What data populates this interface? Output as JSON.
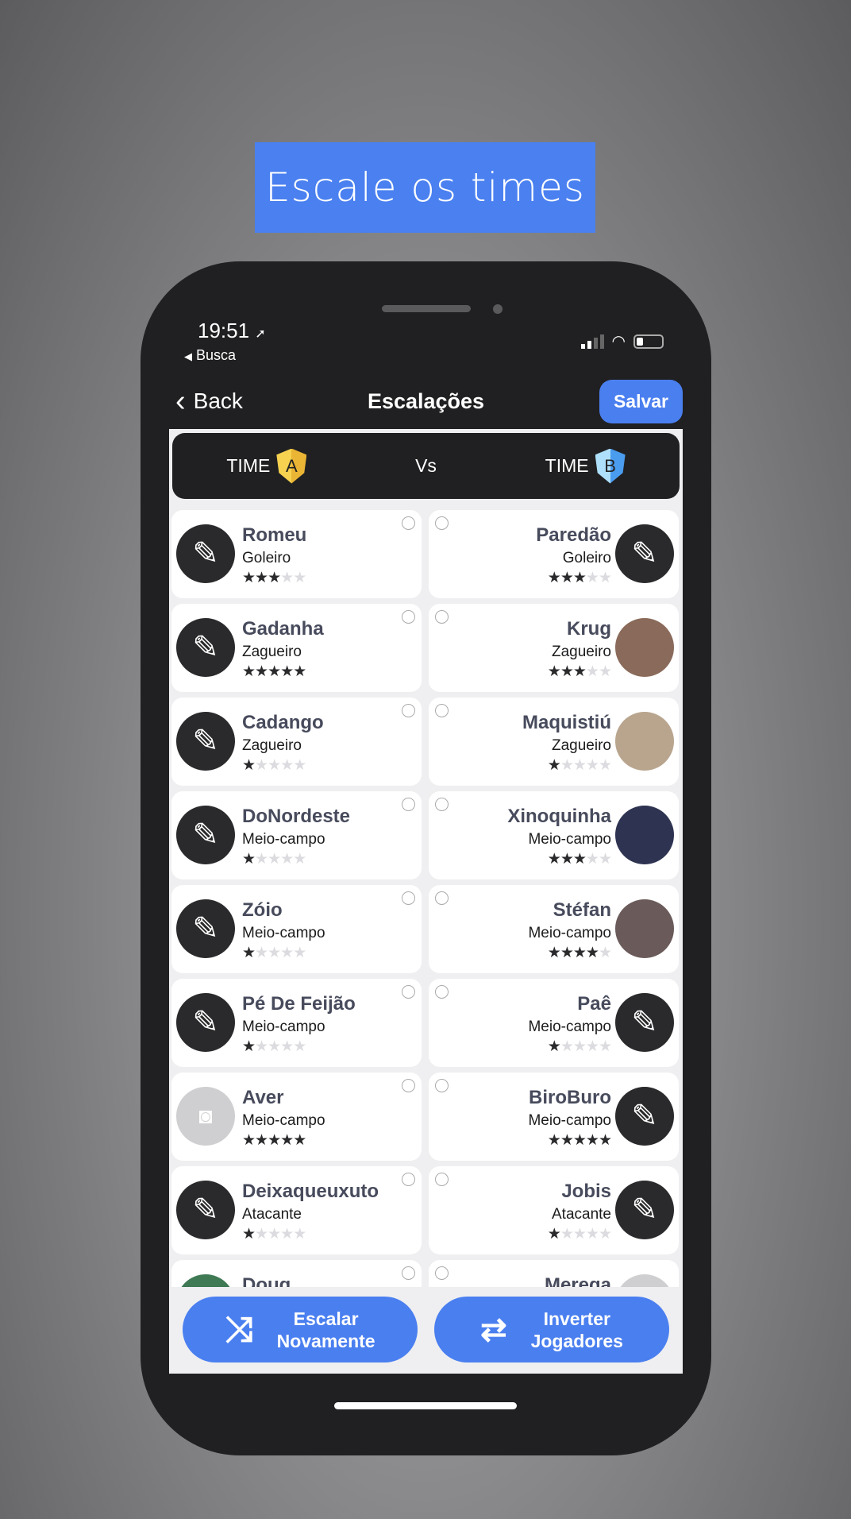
{
  "banner": "Escale os times",
  "status": {
    "time": "19:51",
    "back_app": "Busca"
  },
  "nav": {
    "back": "Back",
    "title": "Escalações",
    "save": "Salvar"
  },
  "teams": {
    "a_label": "TIME",
    "a_badge": "A",
    "vs": "Vs",
    "b_label": "TIME",
    "b_badge": "B",
    "a_color": "#f3c240",
    "b_color": "#5aa8f0"
  },
  "rows": [
    {
      "left": {
        "name": "Romeu",
        "position": "Goleiro",
        "rating": 2.5,
        "avatar": "placeholder"
      },
      "right": {
        "name": "Paredão",
        "position": "Goleiro",
        "rating": 2.5,
        "avatar": "placeholder"
      }
    },
    {
      "left": {
        "name": "Gadanha",
        "position": "Zagueiro",
        "rating": 5,
        "avatar": "placeholder"
      },
      "right": {
        "name": "Krug",
        "position": "Zagueiro",
        "rating": 3,
        "avatar": "photo"
      }
    },
    {
      "left": {
        "name": "Cadango",
        "position": "Zagueiro",
        "rating": 1,
        "avatar": "placeholder"
      },
      "right": {
        "name": "Maquistiú",
        "position": "Zagueiro",
        "rating": 1,
        "avatar": "photo"
      }
    },
    {
      "left": {
        "name": "DoNordeste",
        "position": "Meio-campo",
        "rating": 1,
        "avatar": "placeholder"
      },
      "right": {
        "name": "Xinoquinha",
        "position": "Meio-campo",
        "rating": 3,
        "avatar": "photo"
      }
    },
    {
      "left": {
        "name": "Zóio",
        "position": "Meio-campo",
        "rating": 1,
        "avatar": "placeholder"
      },
      "right": {
        "name": "Stéfan",
        "position": "Meio-campo",
        "rating": 4,
        "avatar": "photo"
      }
    },
    {
      "left": {
        "name": "Pé De Feijão",
        "position": "Meio-campo",
        "rating": 1,
        "avatar": "placeholder"
      },
      "right": {
        "name": "Paê",
        "position": "Meio-campo",
        "rating": 1,
        "avatar": "placeholder"
      }
    },
    {
      "left": {
        "name": "Aver",
        "position": "Meio-campo",
        "rating": 5,
        "avatar": "camera"
      },
      "right": {
        "name": "BiroBuro",
        "position": "Meio-campo",
        "rating": 5,
        "avatar": "placeholder"
      }
    },
    {
      "left": {
        "name": "Deixaqueuxuto",
        "position": "Atacante",
        "rating": 1,
        "avatar": "placeholder"
      },
      "right": {
        "name": "Jobis",
        "position": "Atacante",
        "rating": 1,
        "avatar": "placeholder"
      }
    },
    {
      "left": {
        "name": "Doug",
        "position": "",
        "rating": 0,
        "avatar": "photo"
      },
      "right": {
        "name": "Merega",
        "position": "",
        "rating": 0,
        "avatar": "camera"
      }
    }
  ],
  "buttons": {
    "reshuffle": "Escalar\nNovamente",
    "swap": "Inverter\nJogadores"
  }
}
